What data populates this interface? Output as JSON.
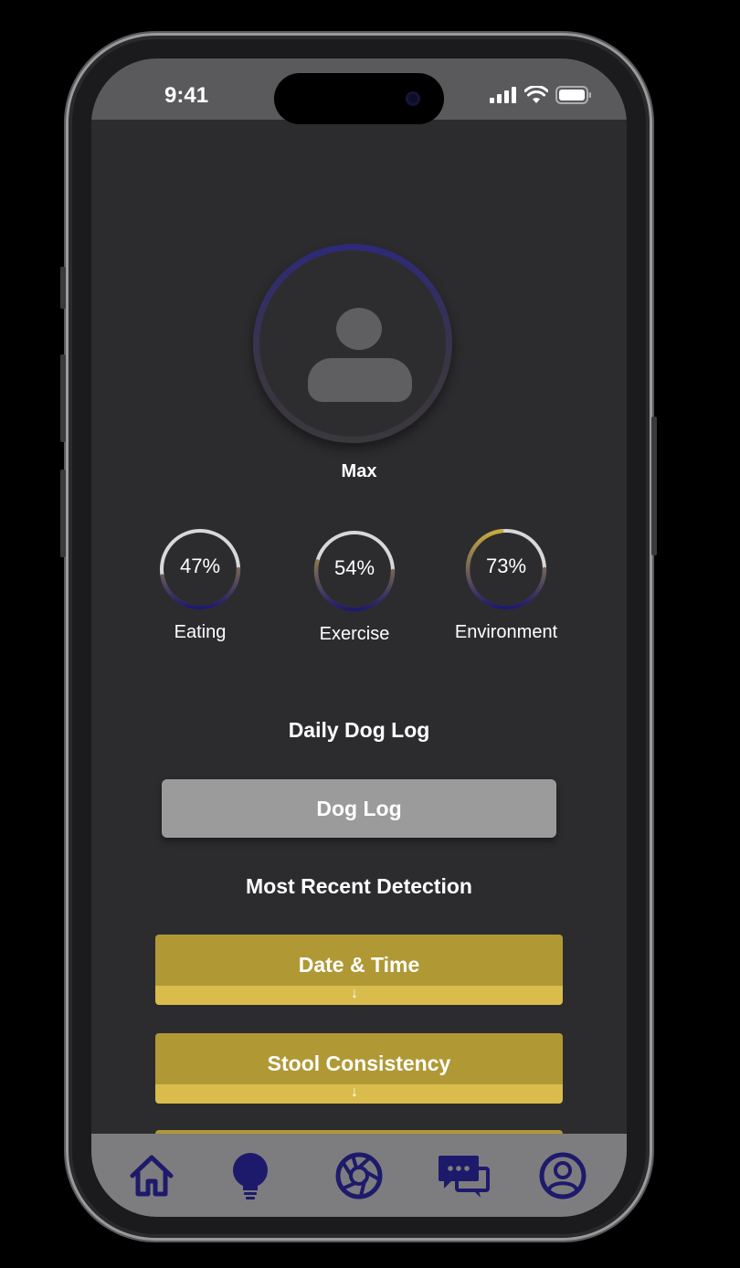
{
  "status_bar": {
    "time": "9:41"
  },
  "profile": {
    "name": "Max"
  },
  "metrics": [
    {
      "label": "Eating",
      "value_text": "47%",
      "percent": 47
    },
    {
      "label": "Exercise",
      "value_text": "54%",
      "percent": 54
    },
    {
      "label": "Environment",
      "value_text": "73%",
      "percent": 73
    }
  ],
  "daily_log": {
    "title": "Daily Dog Log",
    "button_label": "Dog Log"
  },
  "detection": {
    "title": "Most Recent Detection",
    "items": [
      {
        "label": "Date & Time"
      },
      {
        "label": "Stool Consistency"
      }
    ],
    "expand_arrow": "↓"
  },
  "nav": {
    "items": [
      {
        "icon": "home-icon"
      },
      {
        "icon": "lightbulb-icon"
      },
      {
        "icon": "camera-aperture-icon"
      },
      {
        "icon": "chat-icon"
      },
      {
        "icon": "profile-icon"
      }
    ]
  },
  "colors": {
    "screen_bg": "#2c2c2e",
    "nav_bg": "#7d7d7f",
    "accent_navy": "#1e1a6b",
    "accent_gold": "#b09835",
    "gold_light": "#d9bc4c",
    "button_gray": "#9b9b9b"
  }
}
